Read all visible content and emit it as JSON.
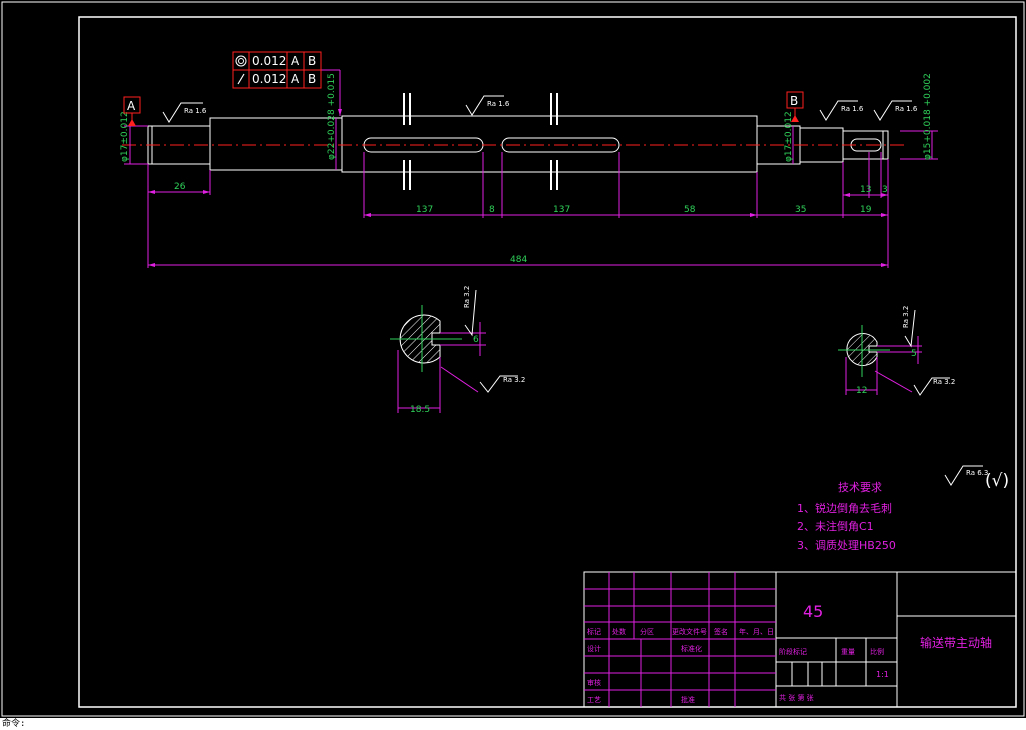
{
  "drawing": {
    "colors": {
      "background": "#000000",
      "outline": "#ffffff",
      "dimension": "#e020e0",
      "text_dim": "#2fd25a",
      "centerline": "#ff2020",
      "datum": "#ff2020"
    },
    "tolerance": [
      {
        "symbol": "concentricity-icon",
        "value": "0.012",
        "ref1": "A",
        "ref2": "B"
      },
      {
        "symbol": "runout-icon",
        "value": "0.012",
        "ref1": "A",
        "ref2": "B"
      }
    ],
    "datums": {
      "a": "A",
      "b": "B"
    },
    "roughness": {
      "ra16": "Ra 1.6",
      "ra32": "Ra 3.2",
      "ra63": "Ra 6.3",
      "rest_symbol": "(√)"
    },
    "diameters": {
      "d1": "φ17±0.012",
      "d2": "φ22+0.028 +0.015",
      "d3": "φ17±0.012",
      "d4": "φ15+0.018 +0.002"
    },
    "dims": {
      "d26": "26",
      "d137a": "137",
      "d8": "8",
      "d137b": "137",
      "d58": "58",
      "d35": "35",
      "d19": "19",
      "d13": "13",
      "d3": "3",
      "d484": "484",
      "s1_width": "18.5",
      "s1_key": "6",
      "s2_width": "12",
      "s2_key": "5"
    },
    "tech_req": {
      "title": "技术要求",
      "items": [
        "1、锐边倒角去毛刺",
        "2、未注倒角C1",
        "3、调质处理HB250"
      ]
    },
    "title_block": {
      "material": "45",
      "part_name": "输送带主动轴",
      "scale": "1:1",
      "h_mark": "标记",
      "h_count": "处数",
      "h_zone": "分区",
      "h_doc": "更改文件号",
      "h_sign": "签名",
      "h_date": "年、月、日",
      "design": "设计",
      "std": "标准化",
      "check": "审核",
      "process": "工艺",
      "approve": "批准",
      "stage": "阶段标记",
      "weight": "重量",
      "ratio": "比例",
      "sheet": "共 张 第 张"
    },
    "command_line": "命令:"
  }
}
